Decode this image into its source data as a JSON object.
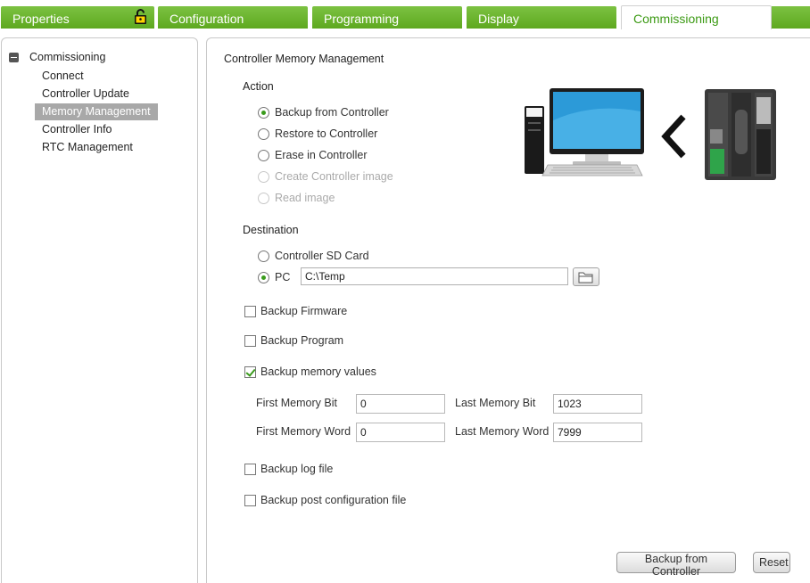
{
  "tabs": [
    {
      "label": "Properties",
      "locked": true
    },
    {
      "label": "Configuration"
    },
    {
      "label": "Programming"
    },
    {
      "label": "Display"
    },
    {
      "label": "Commissioning",
      "active": true
    }
  ],
  "tree": {
    "root": "Commissioning",
    "items": [
      "Connect",
      "Controller Update",
      "Memory Management",
      "Controller Info",
      "RTC Management"
    ],
    "selected": "Memory Management"
  },
  "main": {
    "title": "Controller Memory Management",
    "action": {
      "label": "Action",
      "options": [
        {
          "label": "Backup from Controller",
          "checked": true,
          "disabled": false
        },
        {
          "label": "Restore to Controller",
          "checked": false,
          "disabled": false
        },
        {
          "label": "Erase in Controller",
          "checked": false,
          "disabled": false
        },
        {
          "label": "Create Controller image",
          "checked": false,
          "disabled": true
        },
        {
          "label": "Read image",
          "checked": false,
          "disabled": true
        }
      ]
    },
    "destination": {
      "label": "Destination",
      "sd_card_label": "Controller SD Card",
      "pc_label": "PC",
      "selected": "PC",
      "path_value": "C:\\Temp"
    },
    "checkboxes": {
      "firmware": {
        "label": "Backup Firmware",
        "checked": false
      },
      "program": {
        "label": "Backup Program",
        "checked": false
      },
      "memory_values": {
        "label": "Backup memory values",
        "checked": true
      },
      "log_file": {
        "label": "Backup log file",
        "checked": false
      },
      "post_config": {
        "label": "Backup post configuration file",
        "checked": false
      }
    },
    "memory": {
      "first_bit_label": "First Memory Bit",
      "first_bit_value": "0",
      "last_bit_label": "Last Memory Bit",
      "last_bit_value": "1023",
      "first_word_label": "First Memory Word",
      "first_word_value": "0",
      "last_word_label": "Last Memory Word",
      "last_word_value": "7999"
    },
    "buttons": {
      "run_label": "Backup from Controller",
      "reset_label": "Reset"
    }
  },
  "colors": {
    "tab_green": "#6cb52e",
    "active_tab_text": "#3c9a14",
    "selection_gray": "#a8a8a8",
    "radio_dot": "#3a9b1c"
  },
  "icons": [
    "lock-icon",
    "folder-icon",
    "computer-illustration",
    "arrow-left-icon",
    "controller-device-illustration"
  ]
}
